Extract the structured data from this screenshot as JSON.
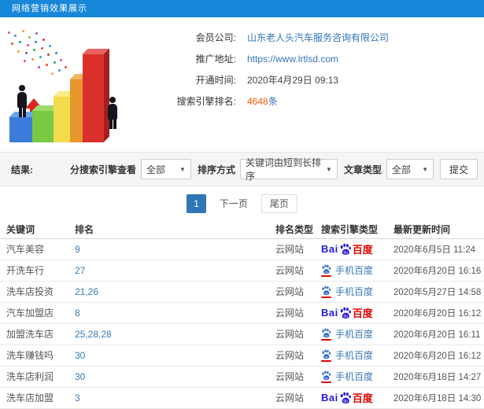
{
  "header": {
    "title": "网络营销效果展示"
  },
  "info": {
    "company_label": "会员公司:",
    "company_value": "山东老人头汽车服务咨询有限公司",
    "url_label": "推广地址:",
    "url_value": "https://www.lrtlsd.com",
    "open_time_label": "开通时间:",
    "open_time_value": "2020年4月29日 09:13",
    "rank_label": "搜索引擎排名:",
    "rank_count": "4648",
    "rank_unit": "条"
  },
  "filters": {
    "result_label": "结果:",
    "engine_filter_label": "分搜索引擎查看",
    "engine_filter_value": "全部",
    "sort_label": "排序方式",
    "sort_value": "关键词由短到长排序",
    "article_type_label": "文章类型",
    "article_type_value": "全部",
    "submit_label": "提交",
    "caret": "▼"
  },
  "pagination": {
    "current": "1",
    "next_label": "下一页",
    "last_label": "尾页"
  },
  "table": {
    "headers": [
      "关键词",
      "排名",
      "排名类型",
      "搜索引擎类型",
      "最新更新时间"
    ],
    "logos": {
      "baidu_bai": "Bai",
      "baidu_du": "du",
      "baidu_cn": "百度",
      "mobile_label": "手机百度"
    },
    "rows": [
      {
        "keyword": "汽车美容",
        "rank": "9",
        "rank_type": "云网站",
        "engine": "baidu",
        "updated": "2020年6月5日 11:24"
      },
      {
        "keyword": "开洗车行",
        "rank": "27",
        "rank_type": "云网站",
        "engine": "mobile",
        "updated": "2020年6月20日 16:16"
      },
      {
        "keyword": "洗车店投资",
        "rank": "21,26",
        "rank_type": "云网站",
        "engine": "mobile",
        "updated": "2020年5月27日 14:58"
      },
      {
        "keyword": "汽车加盟店",
        "rank": "8",
        "rank_type": "云网站",
        "engine": "baidu",
        "updated": "2020年6月20日 16:12"
      },
      {
        "keyword": "加盟洗车店",
        "rank": "25,28,28",
        "rank_type": "云网站",
        "engine": "mobile",
        "updated": "2020年6月20日 16:11"
      },
      {
        "keyword": "洗车赚钱吗",
        "rank": "30",
        "rank_type": "云网站",
        "engine": "mobile",
        "updated": "2020年6月20日 16:12"
      },
      {
        "keyword": "洗车店利润",
        "rank": "30",
        "rank_type": "云网站",
        "engine": "mobile",
        "updated": "2020年6月18日 14:27"
      },
      {
        "keyword": "洗车店加盟",
        "rank": "3",
        "rank_type": "云网站",
        "engine": "baidu",
        "updated": "2020年6月18日 14:30"
      }
    ]
  },
  "colors": {
    "header_bg": "#1787d9",
    "link_blue": "#3374b9",
    "rank_highlight_orange": "#ff5a00",
    "pagination_active_blue": "#2e76b5",
    "baidu_blue": "#2319dc",
    "baidu_red": "#e10602",
    "illustration_bar_colors": [
      "#3b7dd8",
      "#7ac943",
      "#f2dc4b",
      "#e8962e",
      "#d9302c"
    ]
  }
}
